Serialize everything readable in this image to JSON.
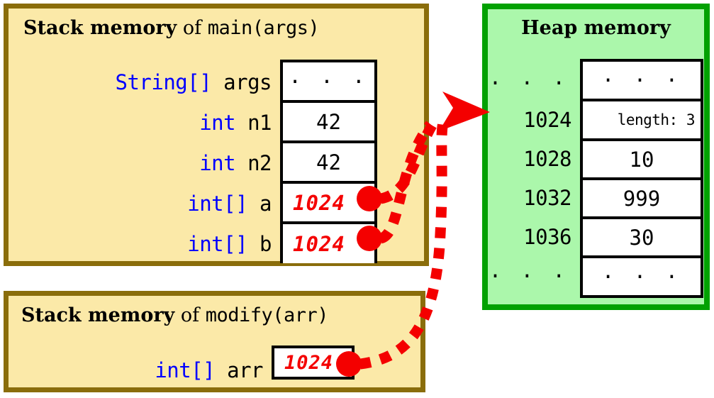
{
  "colors": {
    "stack_fill": "#fbe9a8",
    "stack_border": "#8a6d0b",
    "heap_fill": "#abf7ab",
    "heap_border": "#02a102",
    "pointer_red": "#f40000",
    "type_blue": "#0000ff",
    "cell_border": "#000000"
  },
  "stack_main": {
    "title_bold": "Stack memory",
    "title_of": "of",
    "title_mono": "main(args)",
    "rows": [
      {
        "type": "String[]",
        "name": "args",
        "value": "· · ·",
        "is_pointer": false,
        "is_ellipsis": true
      },
      {
        "type": "int",
        "name": "n1",
        "value": "42",
        "is_pointer": false,
        "is_ellipsis": false
      },
      {
        "type": "int",
        "name": "n2",
        "value": "42",
        "is_pointer": false,
        "is_ellipsis": false
      },
      {
        "type": "int[]",
        "name": "a",
        "value": "1024",
        "is_pointer": true,
        "is_ellipsis": false
      },
      {
        "type": "int[]",
        "name": "b",
        "value": "1024",
        "is_pointer": true,
        "is_ellipsis": false
      }
    ]
  },
  "stack_modify": {
    "title_bold": "Stack memory",
    "title_of": "of",
    "title_mono": "modify(arr)",
    "rows": [
      {
        "type": "int[]",
        "name": "arr",
        "value": "1024",
        "is_pointer": true,
        "is_ellipsis": false
      }
    ]
  },
  "heap": {
    "title": "Heap memory",
    "rows": [
      {
        "address": "· · ·",
        "value": "· · ·",
        "kind": "ellipsis"
      },
      {
        "address": "1024",
        "value": "length: 3",
        "kind": "length"
      },
      {
        "address": "1028",
        "value": "10",
        "kind": "value"
      },
      {
        "address": "1032",
        "value": "999",
        "kind": "value"
      },
      {
        "address": "1036",
        "value": "30",
        "kind": "value"
      },
      {
        "address": "· · ·",
        "value": "· · ·",
        "kind": "ellipsis"
      }
    ]
  },
  "arrows": {
    "target_address": "1024",
    "sources": [
      "int[] a",
      "int[] b",
      "int[] arr"
    ],
    "style": "dotted-red-curve",
    "arrowhead": "right-pointing-triangle"
  }
}
